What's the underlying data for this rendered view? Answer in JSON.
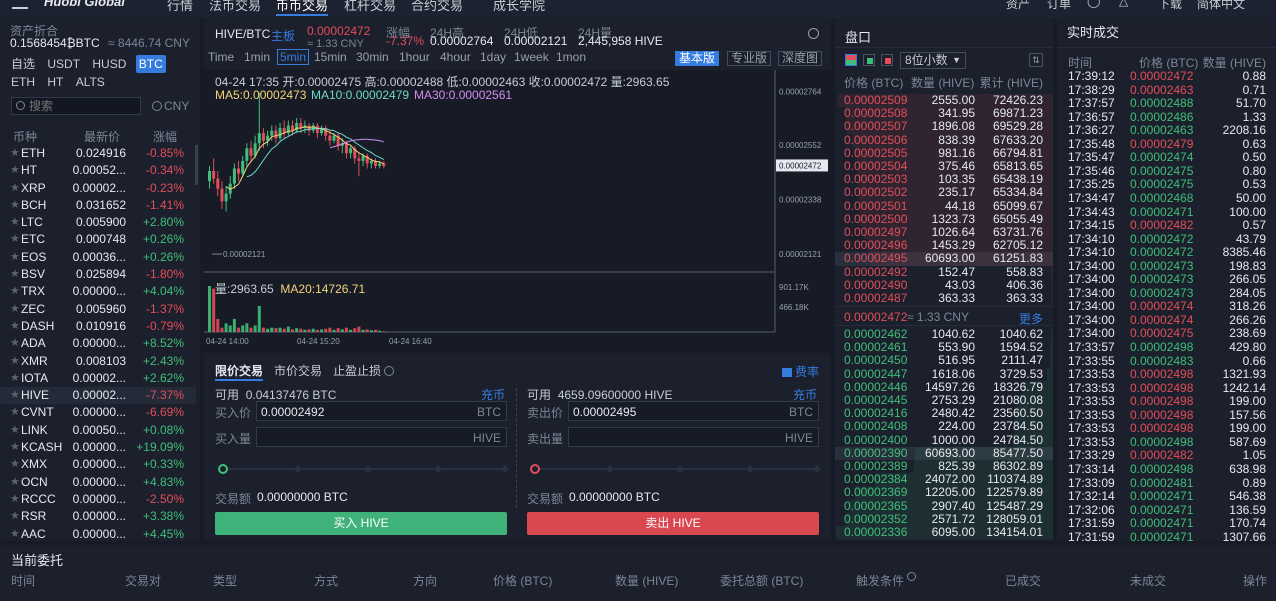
{
  "nav": {
    "logo": "Huobi Global",
    "items": [
      "行情",
      "法币交易",
      "币币交易",
      "杠杆交易",
      "合约交易",
      "成长学院"
    ],
    "active": "币币交易",
    "right": [
      "资产",
      "订单",
      "下载",
      "简体中文"
    ]
  },
  "assets": {
    "label": "资产折合",
    "btc": "0.1568454₿BTC",
    "cny": "≈ 8446.74 CNY"
  },
  "quote_tabs": [
    "自选",
    "USDT",
    "HUSD",
    "BTC",
    "ETH",
    "HT",
    "ALTS"
  ],
  "quote_active": "BTC",
  "search": {
    "placeholder": "搜索",
    "currency": "CNY"
  },
  "coin_cols": {
    "coin": "币种",
    "price": "最新价",
    "change": "涨幅"
  },
  "coins": [
    {
      "sym": "ETH",
      "px": "0.024916",
      "chg": "-0.85%",
      "up": false
    },
    {
      "sym": "HT",
      "px": "0.00052...",
      "chg": "-0.34%",
      "up": false
    },
    {
      "sym": "XRP",
      "px": "0.00002...",
      "chg": "-0.23%",
      "up": false
    },
    {
      "sym": "BCH",
      "px": "0.031652",
      "chg": "-1.41%",
      "up": false
    },
    {
      "sym": "LTC",
      "px": "0.005900",
      "chg": "+2.80%",
      "up": true
    },
    {
      "sym": "ETC",
      "px": "0.000748",
      "chg": "+0.26%",
      "up": true
    },
    {
      "sym": "EOS",
      "px": "0.00036...",
      "chg": "+0.26%",
      "up": true
    },
    {
      "sym": "BSV",
      "px": "0.025894",
      "chg": "-1.80%",
      "up": false
    },
    {
      "sym": "TRX",
      "px": "0.00000...",
      "chg": "+4.04%",
      "up": true
    },
    {
      "sym": "ZEC",
      "px": "0.005960",
      "chg": "-1.37%",
      "up": false
    },
    {
      "sym": "DASH",
      "px": "0.010916",
      "chg": "-0.79%",
      "up": false
    },
    {
      "sym": "ADA",
      "px": "0.00000...",
      "chg": "+8.52%",
      "up": true
    },
    {
      "sym": "XMR",
      "px": "0.008103",
      "chg": "+2.43%",
      "up": true
    },
    {
      "sym": "IOTA",
      "px": "0.00002...",
      "chg": "+2.62%",
      "up": true
    },
    {
      "sym": "HIVE",
      "px": "0.00002...",
      "chg": "-7.37%",
      "up": false
    },
    {
      "sym": "CVNT",
      "px": "0.00000...",
      "chg": "-6.69%",
      "up": false
    },
    {
      "sym": "LINK",
      "px": "0.00050...",
      "chg": "+0.08%",
      "up": true
    },
    {
      "sym": "KCASH",
      "px": "0.00000...",
      "chg": "+19.09%",
      "up": true
    },
    {
      "sym": "XMX",
      "px": "0.00000...",
      "chg": "+0.33%",
      "up": true
    },
    {
      "sym": "OCN",
      "px": "0.00000...",
      "chg": "+4.83%",
      "up": true
    },
    {
      "sym": "RCCC",
      "px": "0.00000...",
      "chg": "-2.50%",
      "up": false
    },
    {
      "sym": "RSR",
      "px": "0.00000...",
      "chg": "+3.38%",
      "up": true
    },
    {
      "sym": "AAC",
      "px": "0.00000...",
      "chg": "+4.45%",
      "up": true
    }
  ],
  "ticker": {
    "pair": "HIVE/BTC",
    "board": "主板",
    "last": "0.00002472",
    "last_cny": "≈ 1.33 CNY",
    "chg_label": "涨幅",
    "chg": "-7.37%",
    "high_label": "24H高",
    "high": "0.00002764",
    "low_label": "24H低",
    "low": "0.00002121",
    "vol_label": "24H量",
    "vol": "2,445,958 HIVE"
  },
  "timeframes": [
    "Time",
    "1min",
    "5min",
    "15min",
    "30min",
    "1hour",
    "4hour",
    "1day",
    "1week",
    "1mon"
  ],
  "tf_active": "5min",
  "views": [
    "基本版",
    "专业版",
    "深度图"
  ],
  "view_active": "基本版",
  "ohlc_line": "04-24 17:35  开:0.00002475 高:0.00002488 低:0.00002463 收:0.00002472 量:2963.65",
  "ma": {
    "ma5": "MA5:0.00002473",
    "ma10": "MA10:0.00002479",
    "ma30": "MA30:0.00002561"
  },
  "vol_line": {
    "vol": "量:2963.65",
    "ma20": "MA20:14726.71"
  },
  "chart_data": {
    "type": "candlestick",
    "y_ticks": [
      "0.00002764",
      "0.00002552",
      "0.00002472",
      "0.00002338",
      "0.00002121"
    ],
    "low_marker": "0.00002121",
    "vol_ticks": [
      "901.17K",
      "466.18K"
    ],
    "x_ticks": [
      "04-24 14:00",
      "04-24 15:20",
      "04-24 16:40"
    ],
    "ylim": [
      2.05e-05,
      2.85e-05
    ],
    "candles": [
      [
        2.41e-05,
        2.45e-05,
        2.38e-05,
        2.47e-05,
        2.12e-05
      ],
      [
        2.45e-05,
        2.42e-05,
        2.4e-05,
        2.5e-05,
        2e-05
      ],
      [
        2.42e-05,
        2.38e-05,
        2.35e-05,
        2.45e-05,
        6e-06
      ],
      [
        2.38e-05,
        2.33e-05,
        2.3e-05,
        2.41e-05,
        2e-06
      ],
      [
        2.33e-05,
        2.36e-05,
        2.29e-05,
        2.39e-05,
        4e-06
      ],
      [
        2.36e-05,
        2.4e-05,
        2.34e-05,
        2.43e-05,
        3e-06
      ],
      [
        2.4e-05,
        2.46e-05,
        2.38e-05,
        2.48e-05,
        6e-06
      ],
      [
        2.46e-05,
        2.44e-05,
        2.41e-05,
        2.49e-05,
        2e-06
      ],
      [
        2.44e-05,
        2.49e-05,
        2.43e-05,
        2.51e-05,
        3e-06
      ],
      [
        2.49e-05,
        2.54e-05,
        2.47e-05,
        2.56e-05,
        4e-06
      ],
      [
        2.54e-05,
        2.51e-05,
        2.49e-05,
        2.57e-05,
        2e-06
      ],
      [
        2.51e-05,
        2.56e-05,
        2.5e-05,
        2.59e-05,
        3e-06
      ],
      [
        2.56e-05,
        2.6e-05,
        2.53e-05,
        2.76e-05,
        1.2e-05
      ],
      [
        2.6e-05,
        2.57e-05,
        2.54e-05,
        2.62e-05,
        2e-06
      ],
      [
        2.57e-05,
        2.59e-05,
        2.55e-05,
        2.61e-05,
        1.5e-06
      ],
      [
        2.59e-05,
        2.61e-05,
        2.57e-05,
        2.63e-05,
        2e-06
      ],
      [
        2.61e-05,
        2.58e-05,
        2.56e-05,
        2.63e-05,
        1.8e-06
      ],
      [
        2.58e-05,
        2.62e-05,
        2.57e-05,
        2.64e-05,
        2e-06
      ],
      [
        2.62e-05,
        2.6e-05,
        2.58e-05,
        2.65e-05,
        1.5e-06
      ],
      [
        2.6e-05,
        2.63e-05,
        2.59e-05,
        2.65e-05,
        2.5e-06
      ],
      [
        2.63e-05,
        2.61e-05,
        2.59e-05,
        2.65e-05,
        1.2e-06
      ],
      [
        2.61e-05,
        2.64e-05,
        2.6e-05,
        2.66e-05,
        1.8e-06
      ],
      [
        2.64e-05,
        2.62e-05,
        2.6e-05,
        2.66e-05,
        1.5e-06
      ],
      [
        2.62e-05,
        2.63e-05,
        2.6e-05,
        2.65e-05,
        1e-06
      ],
      [
        2.63e-05,
        2.61e-05,
        2.59e-05,
        2.64e-05,
        1.2e-06
      ],
      [
        2.61e-05,
        2.63e-05,
        2.6e-05,
        2.64e-05,
        1.5e-06
      ],
      [
        2.63e-05,
        2.6e-05,
        2.58e-05,
        2.64e-05,
        1e-06
      ],
      [
        2.6e-05,
        2.62e-05,
        2.59e-05,
        2.63e-05,
        1.2e-06
      ],
      [
        2.62e-05,
        2.59e-05,
        2.57e-05,
        2.63e-05,
        1.5e-06
      ],
      [
        2.59e-05,
        2.57e-05,
        2.55e-05,
        2.61e-05,
        2e-06
      ],
      [
        2.57e-05,
        2.59e-05,
        2.56e-05,
        2.6e-05,
        1e-06
      ],
      [
        2.59e-05,
        2.55e-05,
        2.53e-05,
        2.6e-05,
        1.8e-06
      ],
      [
        2.55e-05,
        2.56e-05,
        2.52e-05,
        2.58e-05,
        1.2e-06
      ],
      [
        2.56e-05,
        2.52e-05,
        2.5e-05,
        2.57e-05,
        2e-06
      ],
      [
        2.52e-05,
        2.54e-05,
        2.5e-05,
        2.55e-05,
        1e-06
      ],
      [
        2.54e-05,
        2.5e-05,
        2.48e-05,
        2.55e-05,
        1.8e-06
      ],
      [
        2.5e-05,
        2.49e-05,
        2.43e-05,
        2.52e-05,
        2.5e-06
      ],
      [
        2.49e-05,
        2.51e-05,
        2.47e-05,
        2.52e-05,
        1e-06
      ],
      [
        2.51e-05,
        2.48e-05,
        2.46e-05,
        2.52e-05,
        1.2e-06
      ],
      [
        2.48e-05,
        2.49e-05,
        2.46e-05,
        2.5e-05,
        8e-07
      ],
      [
        2.49e-05,
        2.47e-05,
        2.46e-05,
        2.5e-05,
        1e-06
      ],
      [
        2.47e-05,
        2.48e-05,
        2.46e-05,
        2.49e-05,
        6e-07
      ],
      [
        2.48e-05,
        2.47e-05,
        2.46e-05,
        2.49e-05,
        3e-07
      ]
    ]
  },
  "form": {
    "tabs": [
      "限价交易",
      "市价交易",
      "止盈止损"
    ],
    "fee": "费率",
    "buy": {
      "avail_label": "可用",
      "avail": "0.04137476  BTC",
      "deposit": "充币",
      "price_label": "买入价",
      "price": "0.00002492",
      "price_unit": "BTC",
      "qty_label": "买入量",
      "qty_unit": "HIVE",
      "amt_label": "交易额",
      "amt": "0.00000000 BTC",
      "btn": "买入 HIVE"
    },
    "sell": {
      "avail_label": "可用",
      "avail": "4659.09600000  HIVE",
      "deposit": "充币",
      "price_label": "卖出价",
      "price": "0.00002495",
      "price_unit": "BTC",
      "qty_label": "卖出量",
      "qty_unit": "HIVE",
      "amt_label": "交易额",
      "amt": "0.00000000 BTC",
      "btn": "卖出 HIVE"
    }
  },
  "book": {
    "title": "盘口",
    "precision": "8位小数",
    "cols": {
      "price": "价格 (BTC)",
      "amt": "数量 (HIVE)",
      "cum": "累计 (HIVE)"
    },
    "asks": [
      [
        "0.00002509",
        "2555.00",
        "72426.23"
      ],
      [
        "0.00002508",
        "341.95",
        "69871.23"
      ],
      [
        "0.00002507",
        "1896.08",
        "69529.28"
      ],
      [
        "0.00002506",
        "838.39",
        "67633.20"
      ],
      [
        "0.00002505",
        "981.16",
        "66794.81"
      ],
      [
        "0.00002504",
        "375.46",
        "65813.65"
      ],
      [
        "0.00002503",
        "103.35",
        "65438.19"
      ],
      [
        "0.00002502",
        "235.17",
        "65334.84"
      ],
      [
        "0.00002501",
        "44.18",
        "65099.67"
      ],
      [
        "0.00002500",
        "1323.73",
        "65055.49"
      ],
      [
        "0.00002497",
        "1026.64",
        "63731.76"
      ],
      [
        "0.00002496",
        "1453.29",
        "62705.12"
      ],
      [
        "0.00002495",
        "60693.00",
        "61251.83"
      ],
      [
        "0.00002492",
        "152.47",
        "558.83"
      ],
      [
        "0.00002490",
        "43.03",
        "406.36"
      ],
      [
        "0.00002487",
        "363.33",
        "363.33"
      ]
    ],
    "mark_price": "0.00002472",
    "mark_cny": "≈ 1.33 CNY",
    "more": "更多",
    "bids": [
      [
        "0.00002462",
        "1040.62",
        "1040.62"
      ],
      [
        "0.00002461",
        "553.90",
        "1594.52"
      ],
      [
        "0.00002450",
        "516.95",
        "2111.47"
      ],
      [
        "0.00002447",
        "1618.06",
        "3729.53"
      ],
      [
        "0.00002446",
        "14597.26",
        "18326.79"
      ],
      [
        "0.00002445",
        "2753.29",
        "21080.08"
      ],
      [
        "0.00002416",
        "2480.42",
        "23560.50"
      ],
      [
        "0.00002408",
        "224.00",
        "23784.50"
      ],
      [
        "0.00002400",
        "1000.00",
        "24784.50"
      ],
      [
        "0.00002390",
        "60693.00",
        "85477.50"
      ],
      [
        "0.00002389",
        "825.39",
        "86302.89"
      ],
      [
        "0.00002384",
        "24072.00",
        "110374.89"
      ],
      [
        "0.00002369",
        "12205.00",
        "122579.89"
      ],
      [
        "0.00002365",
        "2907.40",
        "125487.29"
      ],
      [
        "0.00002352",
        "2571.72",
        "128059.01"
      ],
      [
        "0.00002336",
        "6095.00",
        "134154.01"
      ]
    ]
  },
  "trades": {
    "title": "实时成交",
    "cols": {
      "time": "时间",
      "price": "价格 (BTC)",
      "amt": "数量 (HIVE)"
    },
    "rows": [
      [
        "17:39:12",
        "0.00002472",
        "0.88",
        false
      ],
      [
        "17:38:29",
        "0.00002463",
        "0.71",
        false
      ],
      [
        "17:37:57",
        "0.00002488",
        "51.70",
        true
      ],
      [
        "17:36:57",
        "0.00002486",
        "1.33",
        true
      ],
      [
        "17:36:27",
        "0.00002463",
        "2208.16",
        true
      ],
      [
        "17:35:48",
        "0.00002479",
        "0.63",
        false
      ],
      [
        "17:35:47",
        "0.00002474",
        "0.50",
        true
      ],
      [
        "17:35:46",
        "0.00002475",
        "0.80",
        true
      ],
      [
        "17:35:25",
        "0.00002475",
        "0.53",
        true
      ],
      [
        "17:34:47",
        "0.00002468",
        "50.00",
        true
      ],
      [
        "17:34:43",
        "0.00002471",
        "100.00",
        true
      ],
      [
        "17:34:15",
        "0.00002482",
        "0.57",
        false
      ],
      [
        "17:34:10",
        "0.00002472",
        "43.79",
        true
      ],
      [
        "17:34:10",
        "0.00002472",
        "8385.46",
        true
      ],
      [
        "17:34:00",
        "0.00002473",
        "198.83",
        true
      ],
      [
        "17:34:00",
        "0.00002473",
        "266.05",
        true
      ],
      [
        "17:34:00",
        "0.00002473",
        "284.05",
        true
      ],
      [
        "17:34:00",
        "0.00002474",
        "318.26",
        false
      ],
      [
        "17:34:00",
        "0.00002474",
        "266.26",
        false
      ],
      [
        "17:34:00",
        "0.00002475",
        "238.69",
        false
      ],
      [
        "17:33:57",
        "0.00002498",
        "429.80",
        true
      ],
      [
        "17:33:55",
        "0.00002483",
        "0.66",
        true
      ],
      [
        "17:33:53",
        "0.00002498",
        "1321.93",
        false
      ],
      [
        "17:33:53",
        "0.00002498",
        "1242.14",
        false
      ],
      [
        "17:33:53",
        "0.00002498",
        "199.00",
        false
      ],
      [
        "17:33:53",
        "0.00002498",
        "157.56",
        false
      ],
      [
        "17:33:53",
        "0.00002498",
        "199.00",
        false
      ],
      [
        "17:33:53",
        "0.00002498",
        "587.69",
        true
      ],
      [
        "17:33:29",
        "0.00002482",
        "1.05",
        false
      ],
      [
        "17:33:14",
        "0.00002498",
        "638.98",
        true
      ],
      [
        "17:33:09",
        "0.00002481",
        "0.89",
        true
      ],
      [
        "17:32:14",
        "0.00002471",
        "546.38",
        true
      ],
      [
        "17:32:06",
        "0.00002471",
        "136.59",
        true
      ],
      [
        "17:31:59",
        "0.00002471",
        "170.74",
        true
      ],
      [
        "17:31:59",
        "0.00002471",
        "1307.66",
        true
      ]
    ]
  },
  "orders": {
    "title": "当前委托",
    "cols": [
      "时间",
      "交易对",
      "类型",
      "方式",
      "方向",
      "价格 (BTC)",
      "数量 (HIVE)",
      "委托总额 (BTC)",
      "触发条件",
      "已成交",
      "未成交",
      "操作"
    ]
  },
  "colors": {
    "up": "#3fbf7a",
    "down": "#e24e5a",
    "accent": "#357ce1",
    "ma5": "#f5d37a",
    "ma10": "#6ed8c6",
    "ma30": "#d58cf0"
  }
}
